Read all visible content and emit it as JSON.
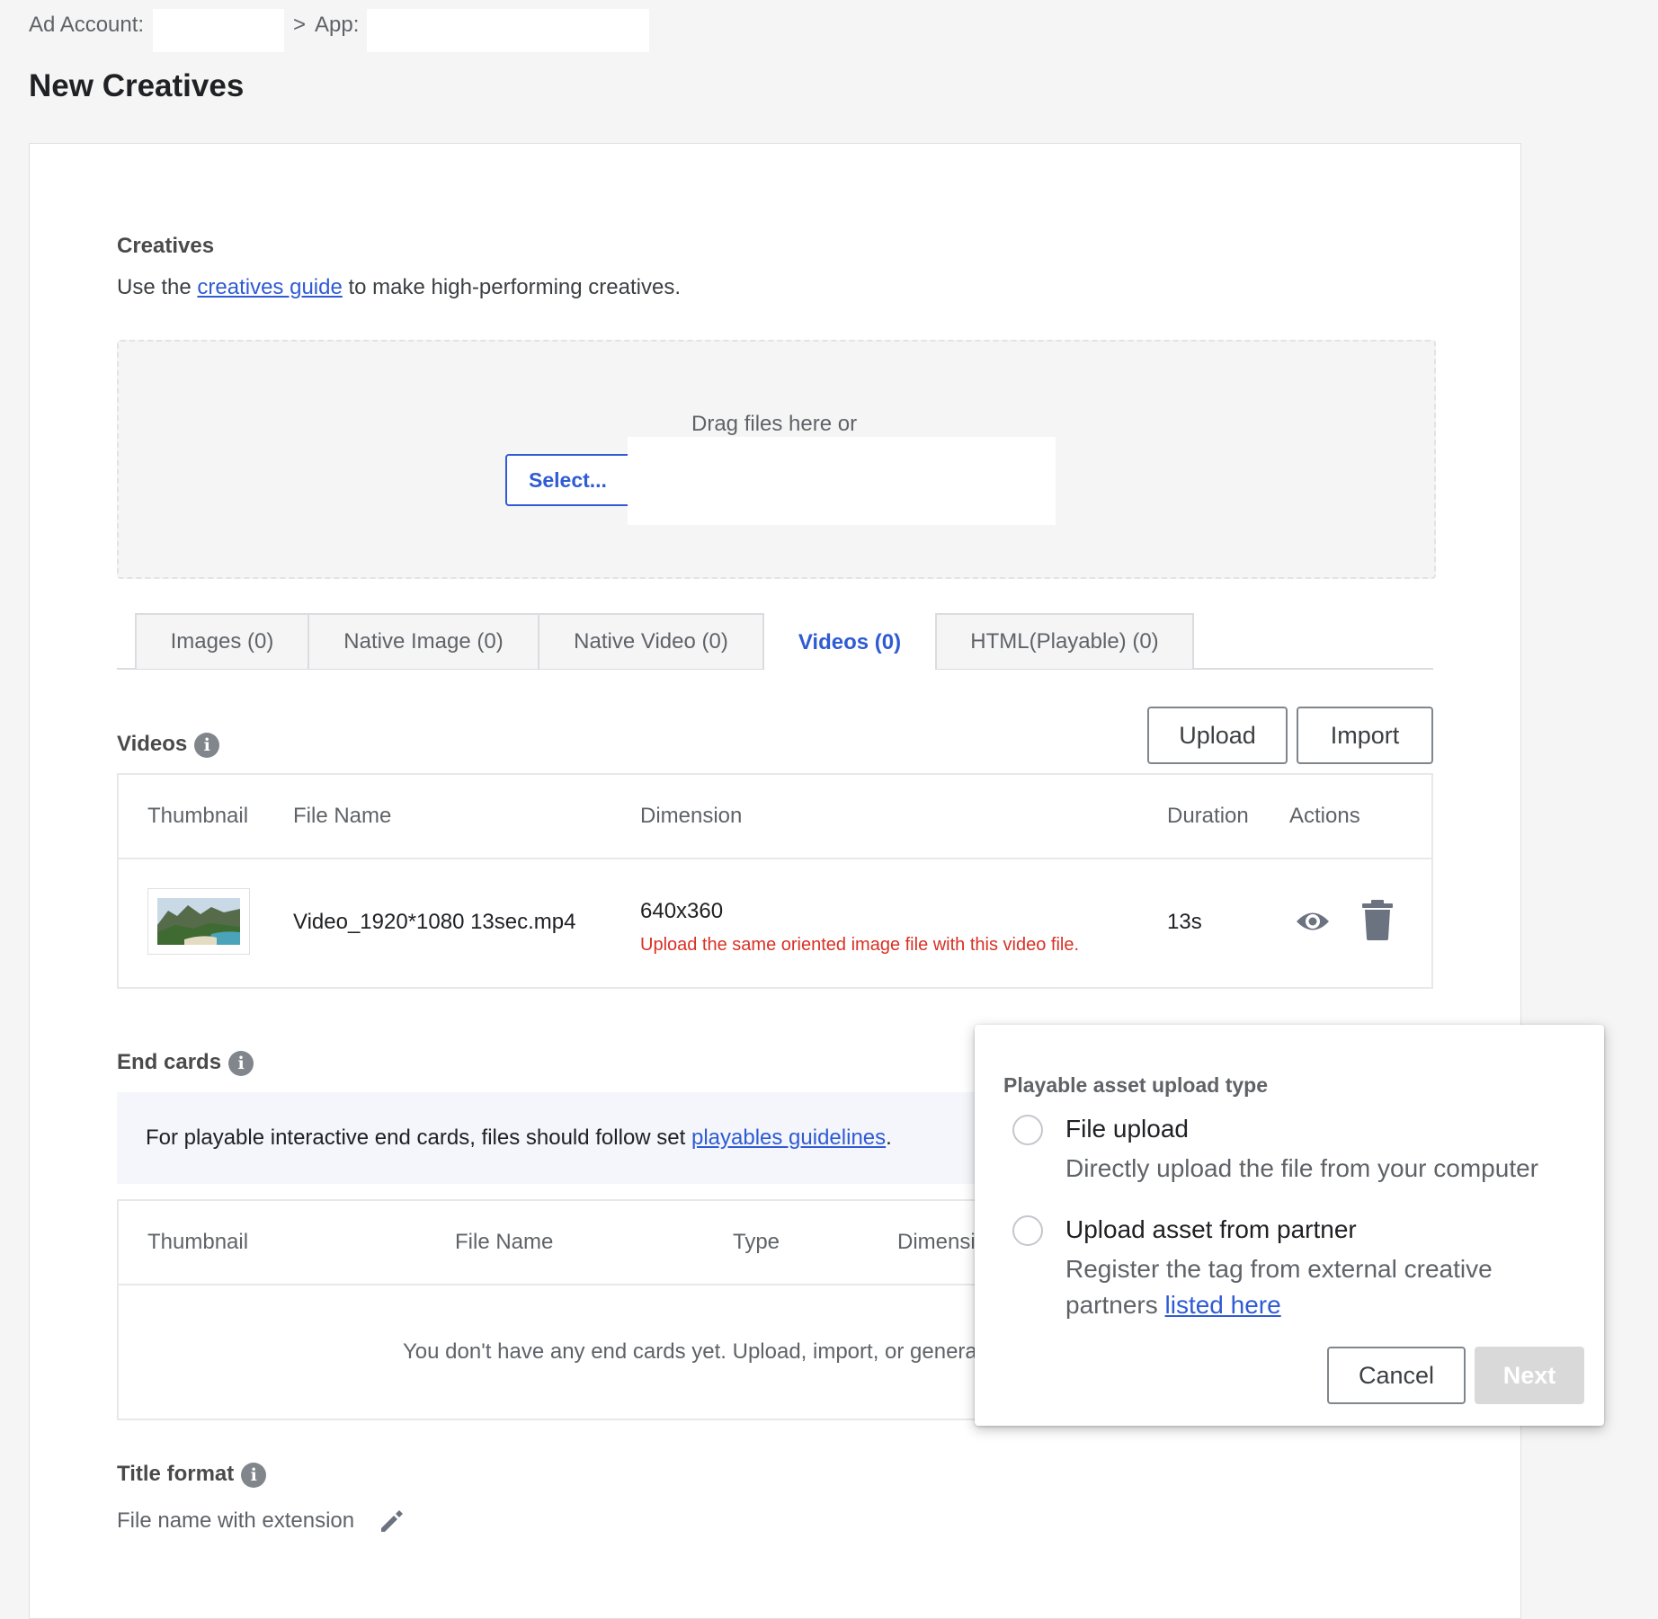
{
  "breadcrumb": {
    "ad_account_label": "Ad Account:",
    "separator": ">",
    "app_label": "App:"
  },
  "page_title": "New Creatives",
  "creatives": {
    "heading": "Creatives",
    "guide_prefix": "Use the ",
    "guide_link": "creatives guide",
    "guide_suffix": " to make high-performing creatives."
  },
  "dropzone": {
    "text": "Drag files here or",
    "select_label": "Select..."
  },
  "tabs": [
    {
      "label": "Images (0)",
      "active": false
    },
    {
      "label": "Native Image (0)",
      "active": false
    },
    {
      "label": "Native Video (0)",
      "active": false
    },
    {
      "label": "Videos (0)",
      "active": true
    },
    {
      "label": "HTML(Playable) (0)",
      "active": false
    }
  ],
  "videos": {
    "heading": "Videos",
    "upload_label": "Upload",
    "import_label": "Import",
    "columns": [
      "Thumbnail",
      "File Name",
      "Dimension",
      "Duration",
      "Actions"
    ],
    "rows": [
      {
        "file_name": "Video_1920*1080 13sec.mp4",
        "dimension": "640x360",
        "warning": "Upload the same oriented image file with this video file.",
        "duration": "13s",
        "actions": [
          "eye-icon",
          "trash-icon"
        ]
      }
    ]
  },
  "end_cards": {
    "heading": "End cards",
    "notice_prefix": "For playable interactive end cards, files should follow set ",
    "notice_link": "playables guidelines",
    "notice_suffix": ".",
    "columns": [
      "Thumbnail",
      "File Name",
      "Type",
      "Dimensi"
    ],
    "empty_text": "You don't have any end cards yet. Upload, import, or genera"
  },
  "title_format": {
    "heading": "Title format",
    "value": "File name with extension"
  },
  "popover": {
    "title": "Playable asset upload type",
    "options": [
      {
        "title": "File upload",
        "desc": "Directly upload the file from your computer",
        "selected": false
      },
      {
        "title": "Upload asset from partner",
        "desc_line1": "Register the tag from external creative",
        "desc_prefix": "partners ",
        "desc_link": "listed here",
        "selected": false
      }
    ],
    "cancel_label": "Cancel",
    "next_label": "Next"
  },
  "colors": {
    "accent": "#2f5bd3",
    "error": "#d93025",
    "background": "#f5f5f5",
    "disabled": "#d9d9d9"
  }
}
